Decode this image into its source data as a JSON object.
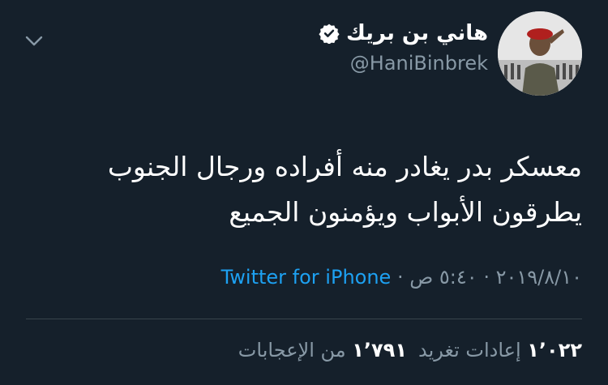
{
  "user": {
    "display_name": "هاني بن بريك",
    "handle": "@HaniBinbrek",
    "verified_icon": "verified-badge-icon"
  },
  "menu": {
    "icon": "chevron-down-icon"
  },
  "tweet": {
    "lines": [
      "معسكر بدر يغادر منه أفراده ورجال الجنوب",
      "يطرقون الأبواب ويؤمنون الجميع"
    ]
  },
  "meta": {
    "time": "٥:٤٠ ص",
    "date": "٢٠١٩/٨/١٠",
    "separator": "·",
    "source": "Twitter for iPhone"
  },
  "stats": {
    "retweets_count": "١٬٠٢٢",
    "retweets_label": "إعادات تغريد",
    "likes_count": "١٬٧٩١",
    "likes_label": "من الإعجابات"
  },
  "colors": {
    "background": "#15202b",
    "secondary_text": "#8899a6",
    "link": "#1da1f2",
    "divider": "#38444d"
  }
}
